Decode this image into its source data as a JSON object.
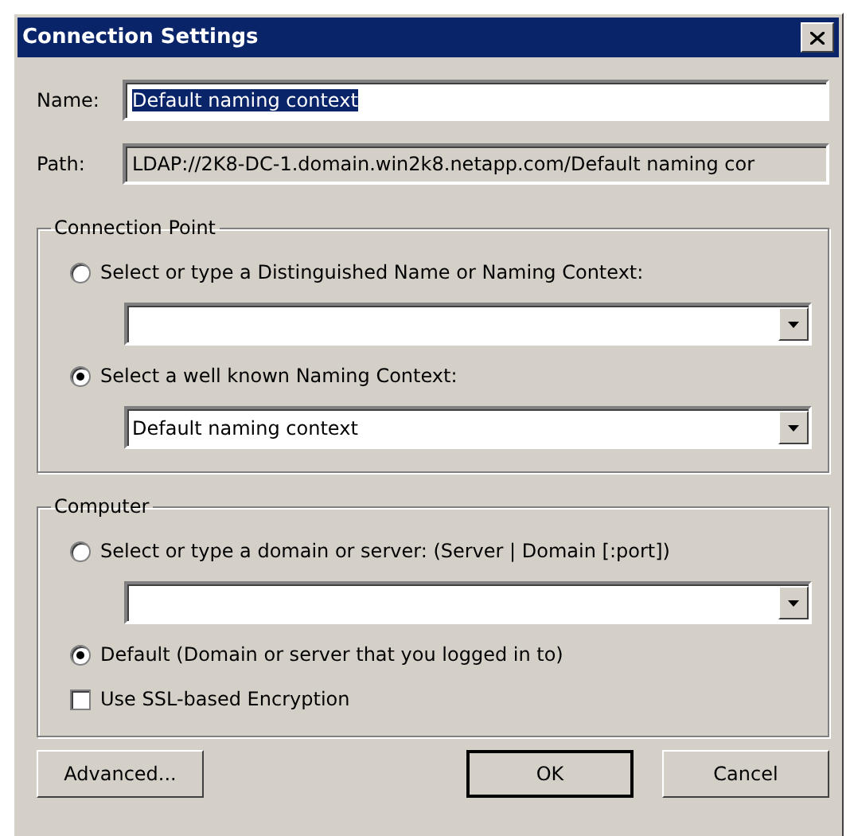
{
  "window": {
    "title": "Connection Settings"
  },
  "name_field": {
    "label": "Name:",
    "value": "Default naming context",
    "text_selected": true
  },
  "path_field": {
    "label": "Path:",
    "value": "LDAP://2K8-DC-1.domain.win2k8.netapp.com/Default naming cor"
  },
  "groups": [
    {
      "title": "Connection Point",
      "items": [
        {
          "kind": "radio",
          "label": "Select or type a Distinguished Name or Naming Context:",
          "selected": false,
          "has_combo": true
        },
        {
          "kind": "radio",
          "label": "Select a well known Naming Context:",
          "selected": true,
          "has_combo": true,
          "combo_value": "Default naming context"
        }
      ]
    },
    {
      "title": "Computer",
      "items": [
        {
          "kind": "radio",
          "label": "Select or type a domain or server: (Server | Domain [:port])",
          "selected": false,
          "has_combo": true
        },
        {
          "kind": "radio",
          "label": "Default (Domain or server that you logged in to)",
          "selected": true
        },
        {
          "kind": "checkbox",
          "label": "Use SSL-based Encryption",
          "checked": false
        }
      ]
    }
  ],
  "buttons": [
    {
      "label": "Advanced...",
      "default": false
    },
    {
      "label": "OK",
      "default": true
    },
    {
      "label": "Cancel",
      "default": false
    }
  ]
}
